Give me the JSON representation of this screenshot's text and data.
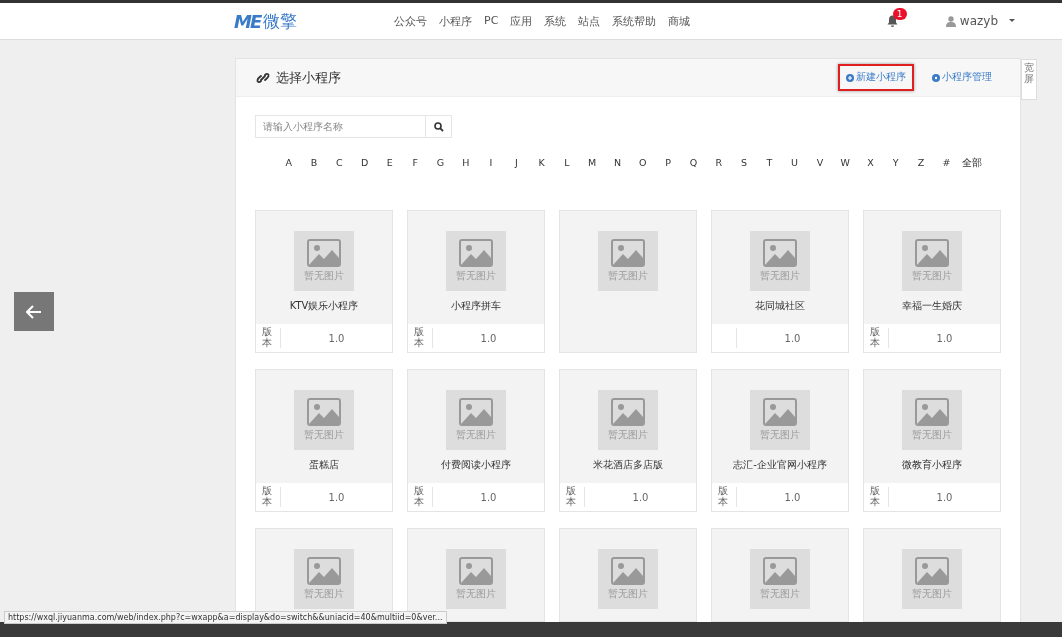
{
  "header": {
    "logo_mark": "ME",
    "logo_text": "微擎",
    "nav": [
      "公众号",
      "小程序",
      "PC",
      "应用",
      "系统",
      "站点",
      "系统帮助",
      "商城"
    ],
    "notification_count": "1",
    "user": "wazyb"
  },
  "panel": {
    "title": "选择小程序",
    "actions": [
      {
        "label": "新建小程序",
        "highlighted": true
      },
      {
        "label": "小程序管理",
        "highlighted": false
      }
    ],
    "side_tab": "宽屏"
  },
  "search": {
    "placeholder": "请输入小程序名称"
  },
  "letters": [
    "A",
    "B",
    "C",
    "D",
    "E",
    "F",
    "G",
    "H",
    "I",
    "J",
    "K",
    "L",
    "M",
    "N",
    "O",
    "P",
    "Q",
    "R",
    "S",
    "T",
    "U",
    "V",
    "W",
    "X",
    "Y",
    "Z",
    "#",
    "全部"
  ],
  "cards": [
    {
      "image_text": "暂无图片",
      "title": "KTV娱乐小程序",
      "version_label": "版本",
      "version": "1.0"
    },
    {
      "image_text": "暂无图片",
      "title": "小程序拼车",
      "version_label": "版本",
      "version": "1.0"
    },
    {
      "image_text": "暂无图片"
    },
    {
      "image_text": "暂无图片",
      "title": "花同城社区",
      "version": "1.0"
    },
    {
      "image_text": "暂无图片",
      "title": "幸福一生婚庆",
      "version_label": "版本",
      "version": "1.0"
    },
    {
      "image_text": "暂无图片",
      "title": "蛋糕店",
      "version_label": "版本",
      "version": "1.0"
    },
    {
      "image_text": "暂无图片",
      "title": "付费阅读小程序",
      "version_label": "版本",
      "version": "1.0"
    },
    {
      "image_text": "暂无图片",
      "title": "米花酒店多店版",
      "version_label": "版本",
      "version": "1.0"
    },
    {
      "image_text": "暂无图片",
      "title": "志汇-企业官网小程序",
      "version_label": "版本",
      "version": "1.0"
    },
    {
      "image_text": "暂无图片",
      "title": "微教育小程序",
      "version_label": "版本",
      "version": "1.0"
    },
    {
      "image_text": "暂无图片"
    },
    {
      "image_text": "暂无图片"
    },
    {
      "image_text": "暂无图片"
    },
    {
      "image_text": "暂无图片"
    },
    {
      "image_text": "暂无图片"
    }
  ],
  "status_url": "https://wxql.jiyuanma.com/web/index.php?c=wxapp&a=display&do=switch&&uniacid=40&multiid=0&ver..."
}
